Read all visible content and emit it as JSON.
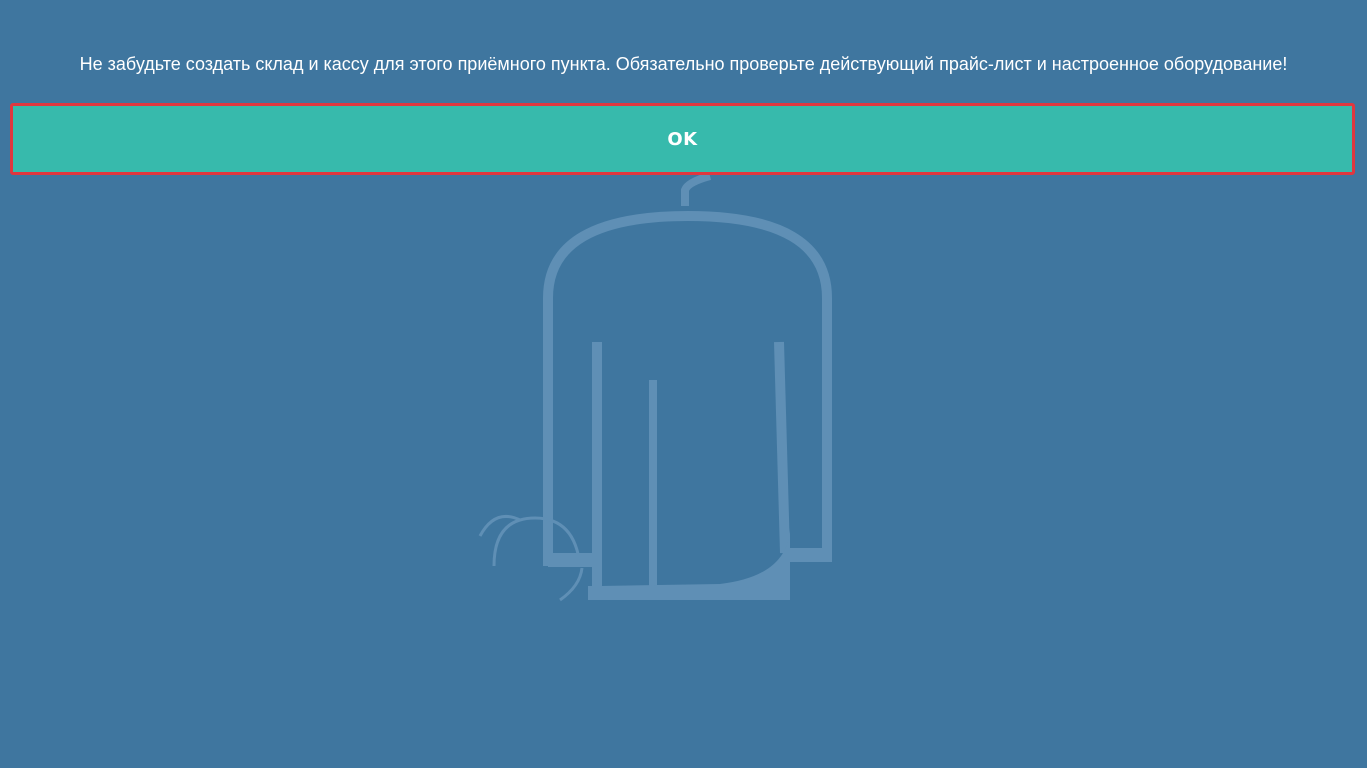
{
  "dialog": {
    "message": "Не забудьте создать склад и кассу для этого приёмного пункта. Обязательно проверьте действующий прайс-лист и настроенное оборудование!",
    "ok_label": "OK"
  },
  "background": {
    "watermark_icon": "washing-bag-icon",
    "bg_color": "#3f769f",
    "button_color": "#37baac",
    "highlight_color": "#e0373f"
  }
}
